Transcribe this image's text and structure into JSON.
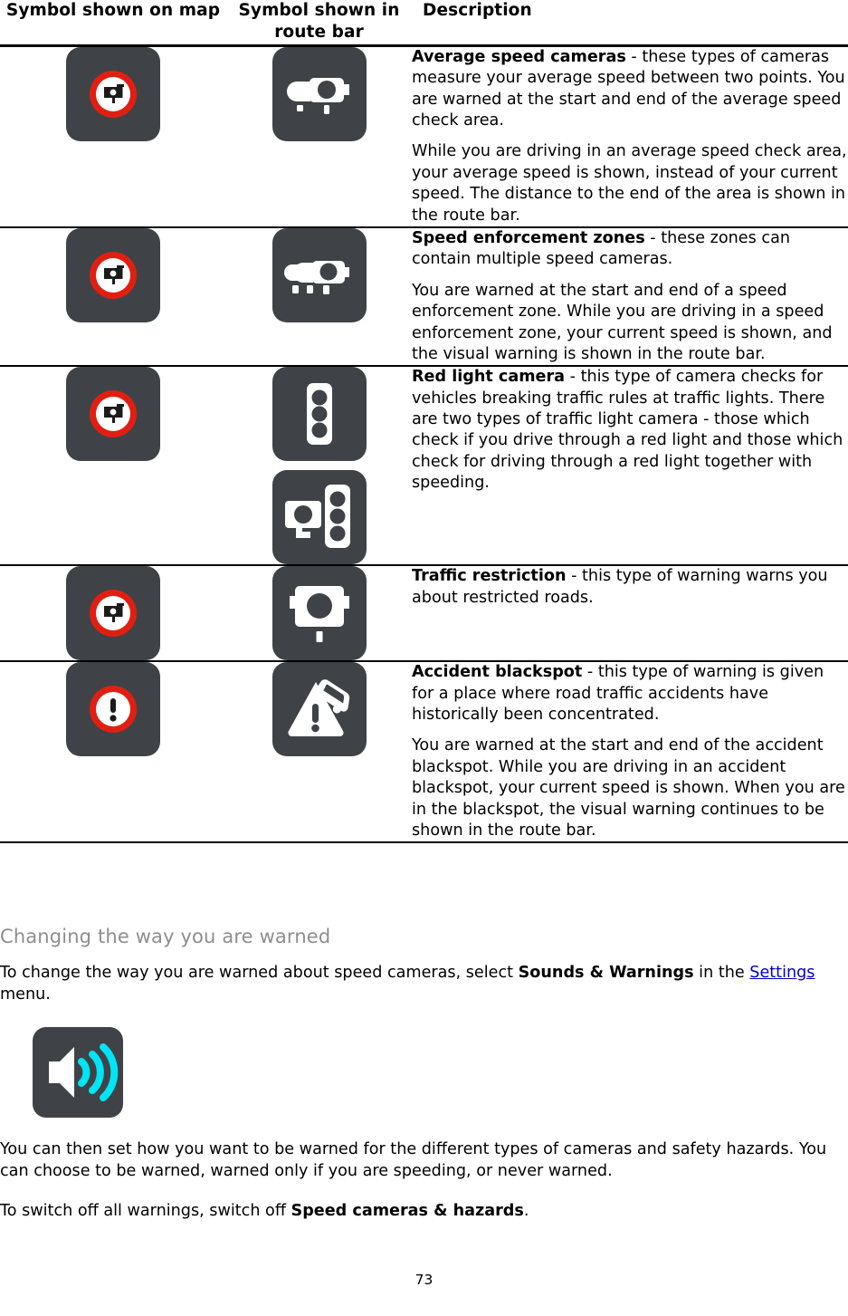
{
  "table": {
    "headers": {
      "map": "Symbol shown on map",
      "route_bar": "Symbol shown in route bar",
      "description": "Description"
    },
    "rows": [
      {
        "map_icon": "speed-camera-sign-icon",
        "route_icon": "average-speed-camera-icon",
        "title": "Average speed cameras",
        "paragraphs": [
          " - these types of cameras measure your average speed between two points. You are warned at the start and end of the average speed check area.",
          "While you are driving in an average speed check area, your average speed is shown, instead of your current speed. The distance to the end of the area is shown in the route bar."
        ]
      },
      {
        "map_icon": "speed-camera-sign-icon",
        "route_icon": "speed-enforcement-zone-icon",
        "title": "Speed enforcement zones",
        "paragraphs": [
          " - these zones can contain multiple speed cameras.",
          "You are warned at the start and end of a speed enforcement zone. While you are driving in a speed enforcement zone, your current speed is shown, and the visual warning is shown in the route bar."
        ]
      },
      {
        "map_icon": "speed-camera-sign-icon",
        "route_icon": "traffic-light-icon",
        "route_icon_2": "red-light-camera-icon",
        "title": "Red light camera",
        "paragraphs": [
          " - this type of camera checks for vehicles breaking traffic rules at traffic lights. There are two types of traffic light camera - those which check if you drive through a red light and those which check for driving through a red light together with speeding."
        ]
      },
      {
        "map_icon": "speed-camera-sign-icon",
        "route_icon": "traffic-restriction-camera-icon",
        "title": "Traffic restriction",
        "paragraphs": [
          " - this type of warning warns you about restricted roads."
        ]
      },
      {
        "map_icon": "warning-exclamation-sign-icon",
        "route_icon": "accident-blackspot-icon",
        "title": "Accident blackspot",
        "paragraphs": [
          " - this type of warning is given for a place where road traffic accidents have historically been concentrated.",
          "You are warned at the start and end of the accident blackspot. While you are driving in an accident blackspot, your current speed is shown. When you are in the blackspot, the visual warning continues to be shown in the route bar."
        ]
      }
    ]
  },
  "section": {
    "heading": "Changing the way you are warned",
    "para1_before": "To change the way you are warned about speed cameras, select ",
    "para1_bold": "Sounds & Warnings",
    "para1_middle": " in the ",
    "para1_link": "Settings",
    "para1_after": " menu.",
    "sound_icon": "sound-warning-icon",
    "para2": "You can then set how you want to be warned for the different types of cameras and safety hazards. You can choose to be warned, warned only if you are speeding, or never warned.",
    "para3_before": "To switch off all warnings, switch off ",
    "para3_bold": "Speed cameras & hazards",
    "para3_after": "."
  },
  "footer": {
    "page_number": "73"
  },
  "colors": {
    "tile_background": "#3f4347",
    "sign_red": "#e01f12",
    "sound_wave_cyan": "#00e5f5",
    "heading_grey": "#8e8e8e",
    "link_blue": "#0000cc"
  }
}
